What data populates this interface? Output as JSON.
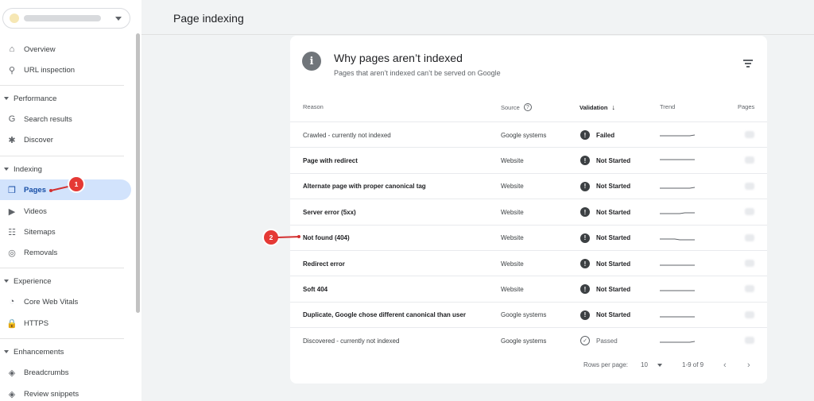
{
  "sidebar": {
    "top_items": [
      {
        "label": "Overview",
        "icon": "⌂",
        "name": "home"
      },
      {
        "label": "URL inspection",
        "icon": "⚲",
        "name": "search"
      }
    ],
    "sections": [
      {
        "label": "Performance",
        "items": [
          {
            "label": "Search results",
            "icon": "G",
            "name": "google"
          },
          {
            "label": "Discover",
            "icon": "✱",
            "name": "asterisk"
          }
        ]
      },
      {
        "label": "Indexing",
        "items": [
          {
            "label": "Pages",
            "icon": "❐",
            "name": "pages"
          },
          {
            "label": "Videos",
            "icon": "▶",
            "name": "video"
          },
          {
            "label": "Sitemaps",
            "icon": "☷",
            "name": "sitemap"
          },
          {
            "label": "Removals",
            "icon": "◎",
            "name": "eye-off"
          }
        ]
      },
      {
        "label": "Experience",
        "items": [
          {
            "label": "Core Web Vitals",
            "icon": "◔",
            "name": "gauge"
          },
          {
            "label": "HTTPS",
            "icon": "🔒",
            "name": "lock"
          }
        ]
      },
      {
        "label": "Enhancements",
        "items": [
          {
            "label": "Breadcrumbs",
            "icon": "◈",
            "name": "layers"
          },
          {
            "label": "Review snippets",
            "icon": "◈",
            "name": "layers"
          }
        ]
      }
    ]
  },
  "header": {
    "title": "Page indexing"
  },
  "card": {
    "title": "Why pages aren’t indexed",
    "subtitle": "Pages that aren’t indexed can’t be served on Google",
    "columns": {
      "reason": "Reason",
      "source": "Source",
      "validation": "Validation",
      "trend": "Trend",
      "pages": "Pages"
    },
    "rows": [
      {
        "reason": "Crawled - currently not indexed",
        "source": "Google systems",
        "validation": "Failed",
        "status": "failed",
        "bold": false,
        "trend": [
          3,
          3,
          3,
          3,
          3,
          3,
          3,
          2
        ]
      },
      {
        "reason": "Page with redirect",
        "source": "Website",
        "validation": "Not Started",
        "status": "not-started",
        "bold": true,
        "trend": [
          1,
          1,
          1,
          1,
          1,
          1,
          1,
          1
        ]
      },
      {
        "reason": "Alternate page with proper canonical tag",
        "source": "Website",
        "validation": "Not Started",
        "status": "not-started",
        "bold": true,
        "trend": [
          4,
          4,
          4,
          4,
          4,
          4,
          4,
          3
        ]
      },
      {
        "reason": "Server error (5xx)",
        "source": "Website",
        "validation": "Not Started",
        "status": "not-started",
        "bold": true,
        "trend": [
          4,
          4,
          4,
          4,
          4,
          3,
          3,
          3
        ]
      },
      {
        "reason": "Not found (404)",
        "source": "Website",
        "validation": "Not Started",
        "status": "not-started",
        "bold": true,
        "trend": [
          3,
          3,
          3,
          3,
          4,
          4,
          4,
          4
        ]
      },
      {
        "reason": "Redirect error",
        "source": "Website",
        "validation": "Not Started",
        "status": "not-started",
        "bold": true,
        "trend": [
          4,
          4,
          4,
          4,
          4,
          4,
          4,
          4
        ]
      },
      {
        "reason": "Soft 404",
        "source": "Website",
        "validation": "Not Started",
        "status": "not-started",
        "bold": true,
        "trend": [
          4,
          4,
          4,
          4,
          4,
          4,
          4,
          4
        ]
      },
      {
        "reason": "Duplicate, Google chose different canonical than user",
        "source": "Google systems",
        "validation": "Not Started",
        "status": "not-started",
        "bold": true,
        "trend": [
          4,
          4,
          4,
          4,
          4,
          4,
          4,
          4
        ]
      },
      {
        "reason": "Discovered - currently not indexed",
        "source": "Google systems",
        "validation": "Passed",
        "status": "passed",
        "bold": false,
        "trend": [
          4,
          4,
          4,
          4,
          4,
          4,
          4,
          3
        ]
      }
    ],
    "footer": {
      "rows_per_page_label": "Rows per page:",
      "rows_per_page": "10",
      "range": "1-9 of 9"
    }
  },
  "callouts": [
    "1",
    "2"
  ],
  "colors": {
    "active_bg": "#d2e3fc",
    "callout": "#e53935",
    "trend": "#5f6368"
  }
}
